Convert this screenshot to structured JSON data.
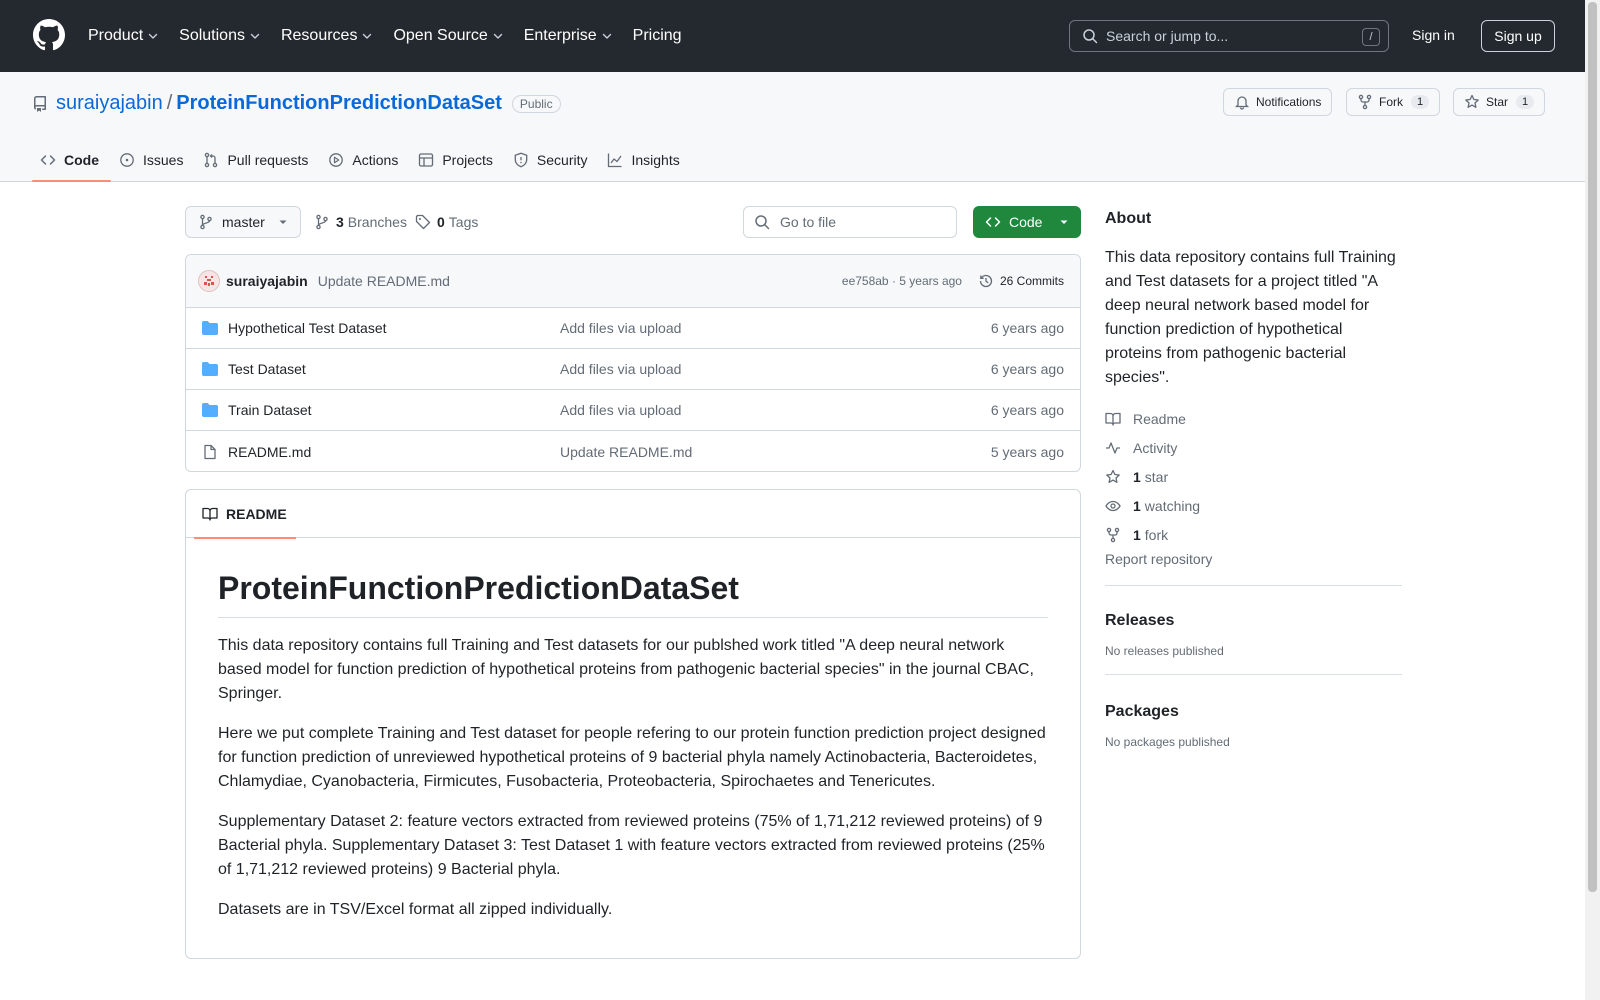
{
  "header": {
    "nav": [
      {
        "label": "Product",
        "dropdown": true
      },
      {
        "label": "Solutions",
        "dropdown": true
      },
      {
        "label": "Resources",
        "dropdown": true
      },
      {
        "label": "Open Source",
        "dropdown": true
      },
      {
        "label": "Enterprise",
        "dropdown": true
      },
      {
        "label": "Pricing",
        "dropdown": false
      }
    ],
    "search_placeholder": "Search or jump to...",
    "search_shortcut": "/",
    "sign_in": "Sign in",
    "sign_up": "Sign up"
  },
  "repo": {
    "owner": "suraiyajabin",
    "separator": "/",
    "name": "ProteinFunctionPredictionDataSet",
    "visibility": "Public",
    "notifications_label": "Notifications",
    "fork_label": "Fork",
    "fork_count": "1",
    "star_label": "Star",
    "star_count": "1"
  },
  "tabs": [
    {
      "label": "Code",
      "icon": "code-icon",
      "active": true
    },
    {
      "label": "Issues",
      "icon": "issue-icon",
      "active": false
    },
    {
      "label": "Pull requests",
      "icon": "pull-request-icon",
      "active": false
    },
    {
      "label": "Actions",
      "icon": "play-icon",
      "active": false
    },
    {
      "label": "Projects",
      "icon": "table-icon",
      "active": false
    },
    {
      "label": "Security",
      "icon": "shield-icon",
      "active": false
    },
    {
      "label": "Insights",
      "icon": "graph-icon",
      "active": false
    }
  ],
  "toolbar": {
    "branch": "master",
    "branches_count": "3",
    "branches_label": "Branches",
    "tags_count": "0",
    "tags_label": "Tags",
    "goto_file": "Go to file",
    "code_button": "Code"
  },
  "latest_commit": {
    "author": "suraiyajabin",
    "message": "Update README.md",
    "hash_age": "ee758ab · 5 years ago",
    "commits": "26 Commits"
  },
  "files": [
    {
      "name": "Hypothetical Test Dataset",
      "type": "folder",
      "message": "Add files via upload",
      "age": "6 years ago"
    },
    {
      "name": "Test Dataset",
      "type": "folder",
      "message": "Add files via upload",
      "age": "6 years ago"
    },
    {
      "name": "Train Dataset",
      "type": "folder",
      "message": "Add files via upload",
      "age": "6 years ago"
    },
    {
      "name": "README.md",
      "type": "file",
      "message": "Update README.md",
      "age": "5 years ago"
    }
  ],
  "readme": {
    "tab": "README",
    "title": "ProteinFunctionPredictionDataSet",
    "paragraphs": [
      "This data repository contains full Training and Test datasets for our publshed work titled \"A deep neural network based model for function prediction of hypothetical proteins from pathogenic bacterial species\" in the journal CBAC, Springer.",
      "Here we put complete Training and Test dataset for people refering to our protein function prediction project designed for function prediction of unreviewed hypothetical proteins of 9 bacterial phyla namely Actinobacteria, Bacteroidetes, Chlamydiae, Cyanobacteria, Firmicutes, Fusobacteria, Proteobacteria, Spirochaetes and Tenericutes.",
      "Supplementary Dataset 2: feature vectors extracted from reviewed proteins (75% of 1,71,212 reviewed proteins) of 9 Bacterial phyla. Supplementary Dataset 3: Test Dataset 1 with feature vectors extracted from reviewed proteins (25% of 1,71,212 reviewed proteins) 9 Bacterial phyla.",
      "Datasets are in TSV/Excel format all zipped individually."
    ]
  },
  "about": {
    "heading": "About",
    "description": "This data repository contains full Training and Test datasets for a project titled \"A deep neural network based model for function prediction of hypothetical proteins from pathogenic bacterial species\".",
    "readme": "Readme",
    "activity": "Activity",
    "stars_count": "1",
    "stars_label": "star",
    "watching_count": "1",
    "watching_label": "watching",
    "forks_count": "1",
    "forks_label": "fork",
    "report": "Report repository"
  },
  "releases": {
    "heading": "Releases",
    "none": "No releases published"
  },
  "packages": {
    "heading": "Packages",
    "none": "No packages published"
  },
  "colors": {
    "header_bg": "#24292f",
    "link": "#0969da",
    "code_btn": "#1f883d",
    "active_tab": "#fd8c73",
    "folder": "#54aeff"
  }
}
